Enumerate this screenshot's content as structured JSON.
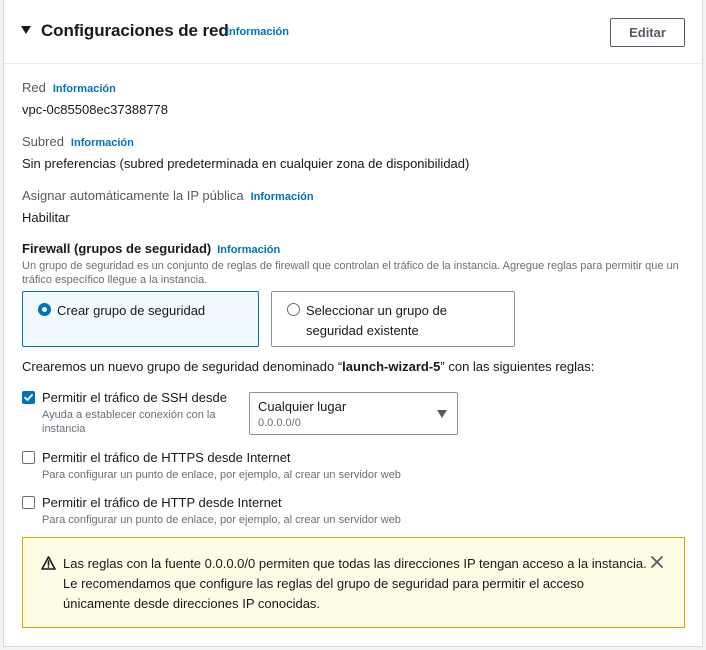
{
  "header": {
    "title": "Configuraciones de red",
    "info_label": "Información",
    "edit_label": "Editar"
  },
  "fields": {
    "network": {
      "label": "Red",
      "info": "Información",
      "value": "vpc-0c85508ec37388778"
    },
    "subnet": {
      "label": "Subred",
      "info": "Información",
      "value": "Sin preferencias (subred predeterminada en cualquier zona de disponibilidad)"
    },
    "public_ip": {
      "label": "Asignar automáticamente la IP pública",
      "info": "Información",
      "value": "Habilitar"
    }
  },
  "firewall": {
    "title": "Firewall (grupos de seguridad)",
    "info": "Información",
    "description": "Un grupo de seguridad es un conjunto de reglas de firewall que controlan el tráfico de la instancia. Agregue reglas para permitir que un tráfico específico llegue a la instancia.",
    "options": [
      {
        "label": "Crear grupo de seguridad",
        "selected": true
      },
      {
        "label": "Seleccionar un grupo de seguridad existente",
        "selected": false
      }
    ],
    "new_group_prefix": "Crearemos un nuevo grupo de seguridad denominado “",
    "new_group_name": "launch-wizard-5",
    "new_group_suffix": "” con las siguientes reglas:"
  },
  "rules": {
    "ssh": {
      "label": "Permitir el tráfico de SSH desde",
      "help": "Ayuda a establecer conexión con la instancia",
      "checked": true,
      "select_value": "Cualquier lugar",
      "select_sub": "0.0.0.0/0"
    },
    "https": {
      "label": "Permitir el tráfico de HTTPS desde Internet",
      "help": "Para configurar un punto de enlace, por ejemplo, al crear un servidor web",
      "checked": false
    },
    "http": {
      "label": "Permitir el tráfico de HTTP desde Internet",
      "help": "Para configurar un punto de enlace, por ejemplo, al crear un servidor web",
      "checked": false
    }
  },
  "alert": {
    "icon": "warning-icon",
    "message": "Las reglas con la fuente 0.0.0.0/0 permiten que todas las direcciones IP tengan acceso a la instancia. Le recomendamos que configure las reglas del grupo de seguridad para permitir el acceso únicamente desde direcciones IP conocidas."
  },
  "colors": {
    "accent": "#0073bb",
    "warning_bg": "#fffce5",
    "warning_border": "#d8a800"
  }
}
